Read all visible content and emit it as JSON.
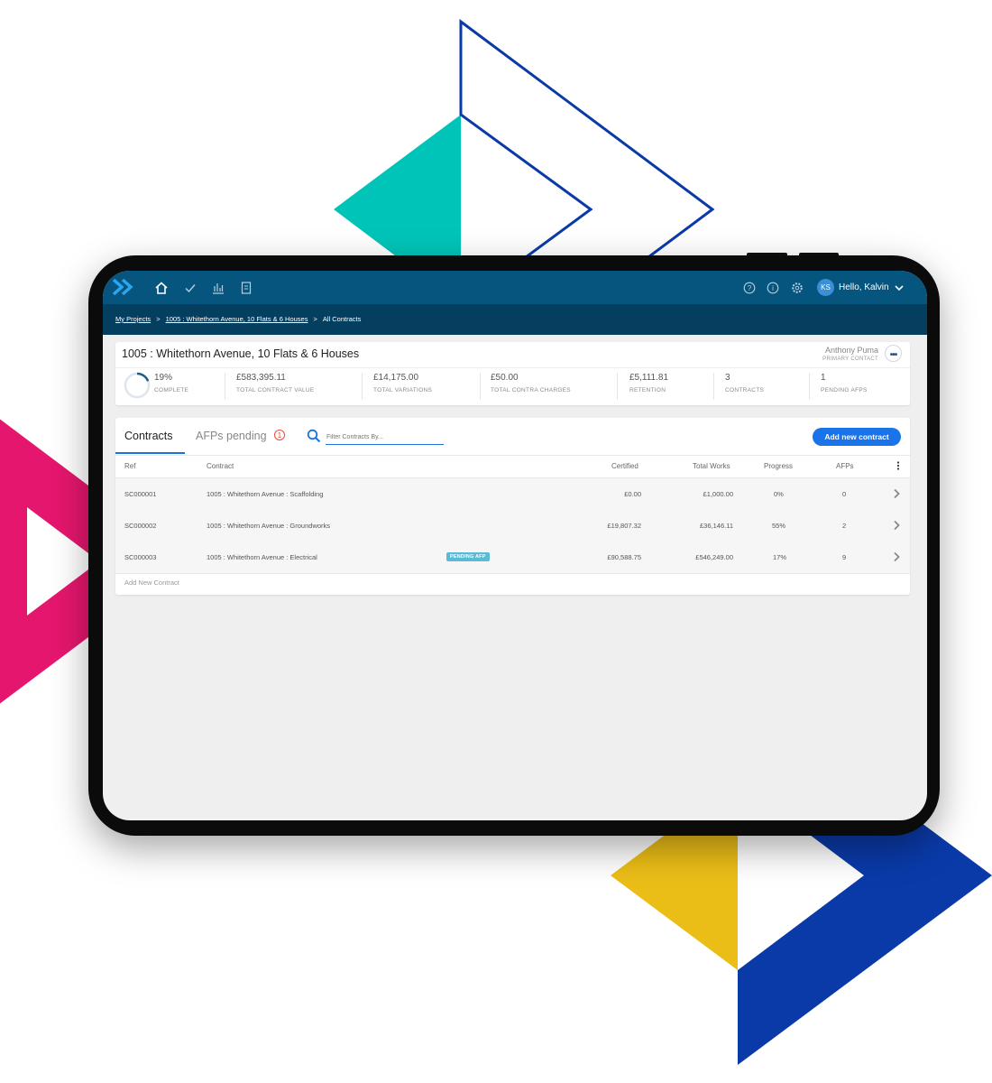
{
  "header": {
    "greeting": "Hello, Kalvin",
    "avatar_initials": "KS",
    "nav_icons": [
      "home-icon",
      "check-icon",
      "bar-chart-icon",
      "document-icon"
    ],
    "right_icons": [
      "help-icon",
      "info-icon",
      "settings-icon"
    ]
  },
  "breadcrumb": {
    "items": [
      "My Projects",
      "1005 : Whitethorn Avenue, 10 Flats & 6 Houses",
      "All Contracts"
    ],
    "separator": ">"
  },
  "project": {
    "title": "1005 : Whitethorn Avenue, 10 Flats & 6 Houses",
    "contact_name": "Anthony Puma",
    "contact_role": "PRIMARY CONTACT",
    "complete_percent": 19,
    "stats": [
      {
        "value": "19%",
        "label": "COMPLETE"
      },
      {
        "value": "£583,395.11",
        "label": "TOTAL CONTRACT VALUE"
      },
      {
        "value": "£14,175.00",
        "label": "TOTAL VARIATIONS"
      },
      {
        "value": "£50.00",
        "label": "TOTAL CONTRA CHARGES"
      },
      {
        "value": "£5,111.81",
        "label": "RETENTION"
      },
      {
        "value": "3",
        "label": "CONTRACTS"
      },
      {
        "value": "1",
        "label": "PENDING AFPS"
      }
    ]
  },
  "tabs": [
    {
      "label": "Contracts",
      "active": true
    },
    {
      "label": "AFPs pending",
      "badge": "1"
    }
  ],
  "filter": {
    "placeholder": "Filter Contracts By..."
  },
  "add_button": "Add new contract",
  "table": {
    "columns": [
      "Ref",
      "Contract",
      "Certified",
      "Total Works",
      "Progress",
      "AFPs"
    ],
    "rows": [
      {
        "ref": "SC000001",
        "contract": "1005 : Whitethorn Avenue : Scaffolding",
        "status": "",
        "certified": "£0.00",
        "total_works": "£1,000.00",
        "progress": "0%",
        "afps": "0"
      },
      {
        "ref": "SC000002",
        "contract": "1005 : Whitethorn Avenue : Groundworks",
        "status": "",
        "certified": "£19,807.32",
        "total_works": "£36,146.11",
        "progress": "55%",
        "afps": "2"
      },
      {
        "ref": "SC000003",
        "contract": "1005 : Whitethorn Avenue : Electrical",
        "status": "PENDING AFP",
        "certified": "£90,588.75",
        "total_works": "£546,249.00",
        "progress": "17%",
        "afps": "9"
      }
    ],
    "add_row_label": "Add New Contract"
  },
  "colors": {
    "topbar": "#05557f",
    "breadbar": "#053f5f",
    "accent": "#1a73e8",
    "pending_pill": "#5bbad5",
    "badge": "#e84c3d",
    "teal": "#00c4b8",
    "navy": "#0a3aa8",
    "magenta": "#e5166d",
    "yellow": "#ebbd17"
  }
}
